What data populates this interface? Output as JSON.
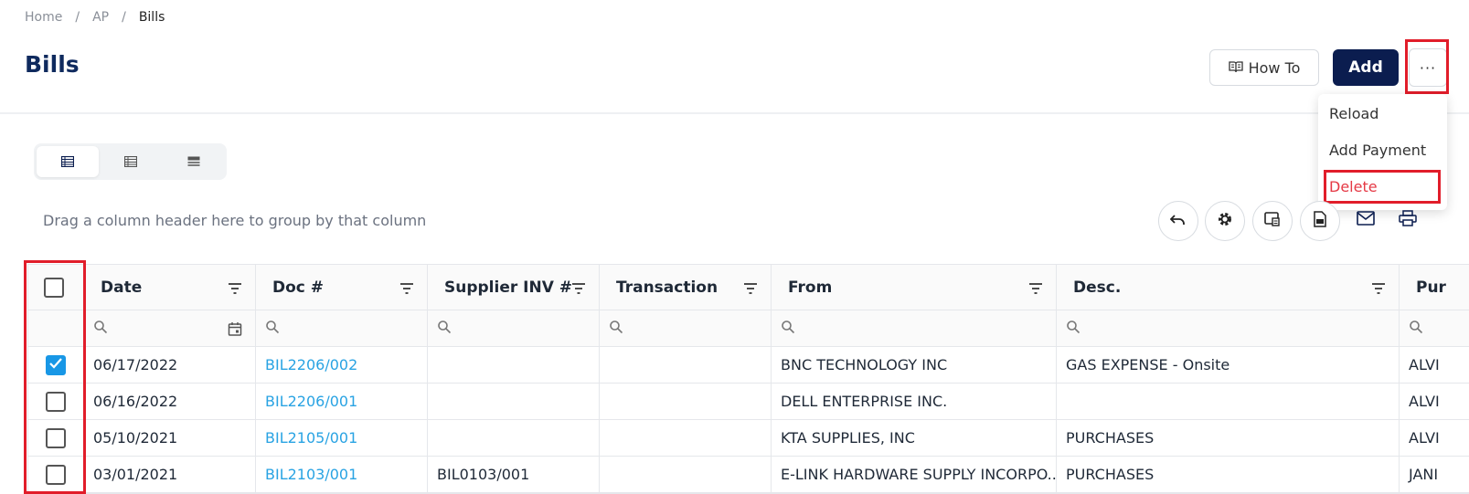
{
  "breadcrumb": {
    "home": "Home",
    "ap": "AP",
    "current": "Bills",
    "separator": "/"
  },
  "page": {
    "title": "Bills"
  },
  "header_buttons": {
    "how_to": "How To",
    "add": "Add",
    "more": "···"
  },
  "more_menu": {
    "items": [
      "Reload",
      "Add Payment",
      "Delete"
    ]
  },
  "grid": {
    "group_hint": "Drag a column header here to group by that column",
    "columns": [
      "Date",
      "Doc #",
      "Supplier INV #",
      "Transaction",
      "From",
      "Desc.",
      "Pur"
    ],
    "rows": [
      {
        "checked": true,
        "date": "06/17/2022",
        "doc": "BIL2206/002",
        "supplier_inv": "",
        "transaction": "",
        "from": "BNC TECHNOLOGY INC",
        "desc": "GAS EXPENSE - Onsite",
        "pur": "ALVI"
      },
      {
        "checked": false,
        "date": "06/16/2022",
        "doc": "BIL2206/001",
        "supplier_inv": "",
        "transaction": "",
        "from": "DELL ENTERPRISE INC.",
        "desc": "",
        "pur": "ALVI"
      },
      {
        "checked": false,
        "date": "05/10/2021",
        "doc": "BIL2105/001",
        "supplier_inv": "",
        "transaction": "",
        "from": "KTA SUPPLIES, INC",
        "desc": "PURCHASES",
        "pur": "ALVI"
      },
      {
        "checked": false,
        "date": "03/01/2021",
        "doc": "BIL2103/001",
        "supplier_inv": "BIL0103/001",
        "transaction": "",
        "from": "E-LINK HARDWARE SUPPLY INCORPO...",
        "desc": "PURCHASES",
        "pur": "JANI"
      }
    ]
  },
  "colors": {
    "primary": "#0b1d4f",
    "title": "#0f2a5e",
    "link": "#29a3e3",
    "danger": "#e53945",
    "highlight": "#e11d2a",
    "checkbox": "#1897e6"
  },
  "icons": [
    "book-icon",
    "more-icon",
    "list-view-icon",
    "table-view-icon",
    "compact-view-icon",
    "undo-icon",
    "gear-icon",
    "export-icon",
    "pdf-icon",
    "mail-icon",
    "print-icon",
    "filter-icon",
    "search-icon",
    "calendar-icon",
    "check-icon"
  ]
}
